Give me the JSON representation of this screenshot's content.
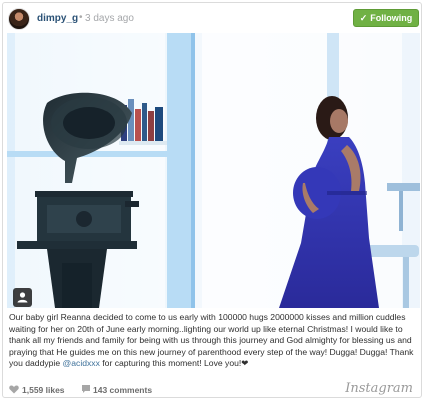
{
  "header": {
    "username": "dimpy_g",
    "separator": "•",
    "time_ago": "3 days ago",
    "follow_label": "Following",
    "follow_check": "✓"
  },
  "caption": {
    "text": "Our baby girl Reanna decided to come to us early with 100000 hugs 2000000 kisses and million cuddles waiting for her on 20th of June early morning..lighting our world up like eternal Christmas! I would like to thank all my friends and family for being with us through this journey and God almighty for blessing us and praying that He guides me on this new journey of parenthood every step of the way! Dugga! Dugga! Thank you daddypie ",
    "mention": "@acidxxx",
    "text_after": " for capturing this moment! Love you!",
    "emoji": "❤"
  },
  "footer": {
    "likes": "1,559 likes",
    "comments": "143 comments",
    "brand": "Instagram"
  },
  "colors": {
    "follow_green": "#70b144",
    "username_blue": "#2b5276",
    "mention_blue": "#3f729b"
  },
  "icons": [
    "user-tag-icon",
    "heart-icon",
    "comment-icon",
    "check-icon"
  ]
}
